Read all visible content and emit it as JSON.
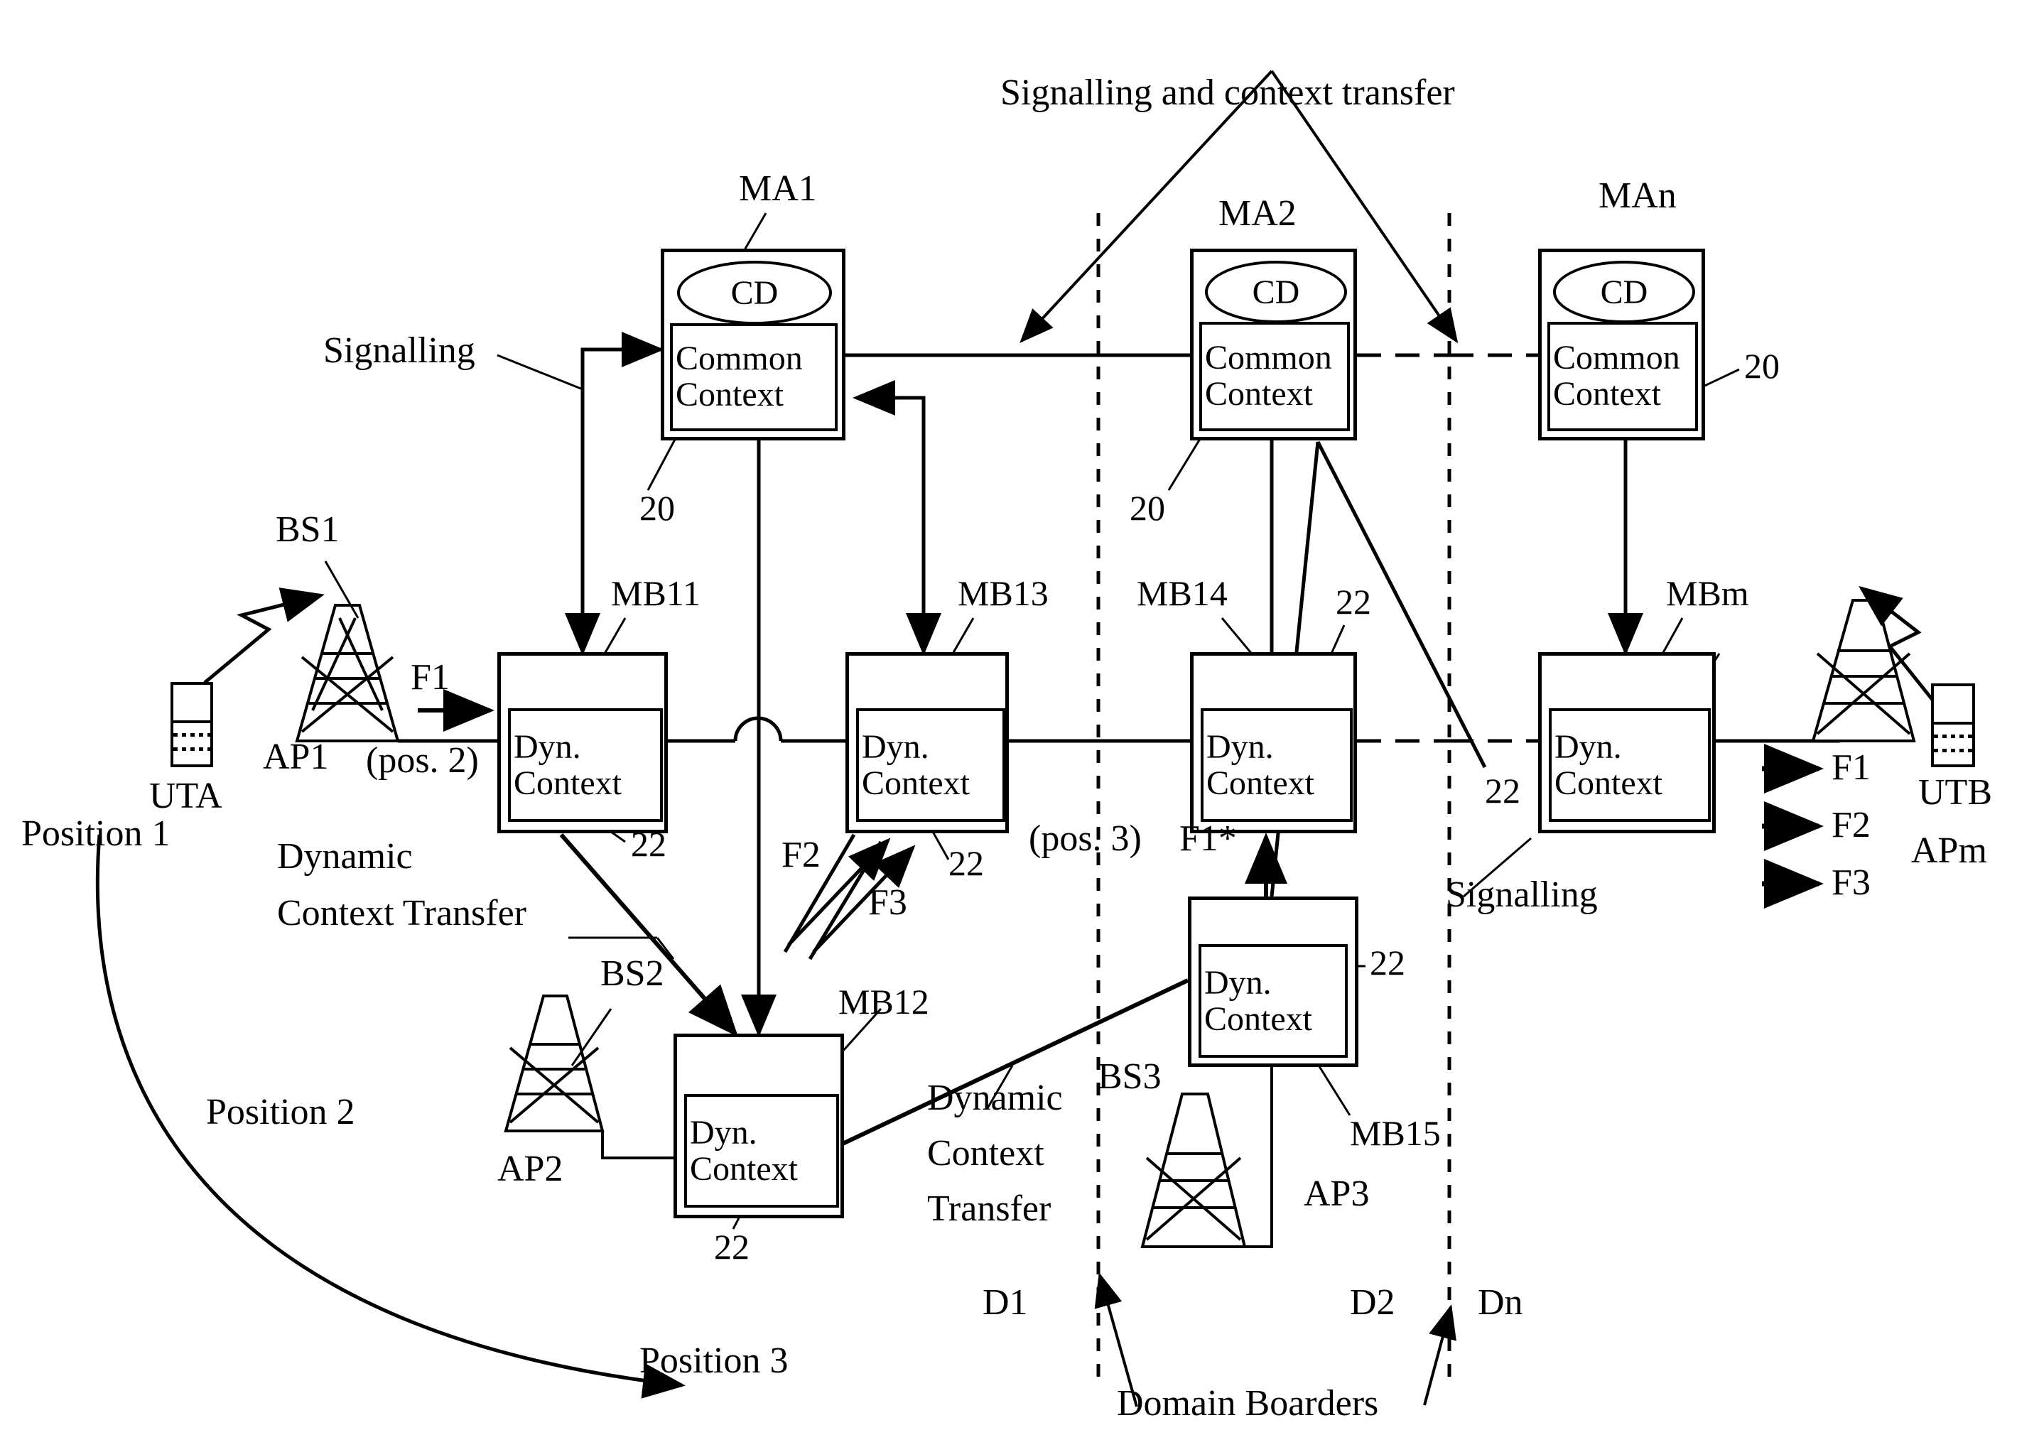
{
  "figure": {
    "title_top": "Signalling and context transfer",
    "domain_label": "Domain Boarders"
  },
  "agents": [
    {
      "id": "MA1",
      "label": "MA1",
      "cd": "CD",
      "context_line1": "Common",
      "context_line2": "Context",
      "ref": "20"
    },
    {
      "id": "MA2",
      "label": "MA2",
      "cd": "CD",
      "context_line1": "Common",
      "context_line2": "Context",
      "ref": "20"
    },
    {
      "id": "MAn",
      "label": "MAn",
      "cd": "CD",
      "context_line1": "Common",
      "context_line2": "Context",
      "ref": "20"
    }
  ],
  "brokers": [
    {
      "id": "MB11",
      "label": "MB11",
      "dyn_line1": "Dyn.",
      "dyn_line2": "Context",
      "ref": "22"
    },
    {
      "id": "MB13",
      "label": "MB13",
      "dyn_line1": "Dyn.",
      "dyn_line2": "Context",
      "ref": "22"
    },
    {
      "id": "MB14",
      "label": "MB14",
      "dyn_line1": "Dyn.",
      "dyn_line2": "Context",
      "ref": "22"
    },
    {
      "id": "MBm",
      "label": "MBm",
      "dyn_line1": "Dyn.",
      "dyn_line2": "Context",
      "ref": "22"
    },
    {
      "id": "MB12",
      "label": "MB12",
      "dyn_line1": "Dyn.",
      "dyn_line2": "Context",
      "ref": "22"
    },
    {
      "id": "MB15",
      "label": "MB15",
      "dyn_line1": "Dyn.",
      "dyn_line2": "Context",
      "ref": "22"
    }
  ],
  "base_stations": [
    {
      "id": "BS1",
      "label": "BS1",
      "ap": "AP1"
    },
    {
      "id": "BS2",
      "label": "BS2",
      "ap": "AP2"
    },
    {
      "id": "BS3",
      "label": "BS3",
      "ap": "AP3"
    },
    {
      "id": "BSm",
      "label": "",
      "ap": "APm"
    }
  ],
  "terminals": [
    {
      "id": "UTA",
      "label": "UTA"
    },
    {
      "id": "UTB",
      "label": "UTB"
    }
  ],
  "positions": {
    "p1": "Position 1",
    "p2": "Position 2",
    "p3": "Position 3",
    "pos2_tag": "(pos. 2)",
    "pos3_tag": "(pos. 3)"
  },
  "flows": {
    "f1": "F1",
    "f2": "F2",
    "f3": "F3",
    "f1_star": "F1*",
    "right_f1": "F1",
    "right_f2": "F2",
    "right_f3": "F3"
  },
  "annotations": {
    "signalling_left": "Signalling",
    "signalling_right": "Signalling",
    "dct_left_line1": "Dynamic",
    "dct_left_line2": "Context Transfer",
    "dct_mid_line1": "Dynamic",
    "dct_mid_line2": "Context",
    "dct_mid_line3": "Transfer"
  },
  "domains": [
    {
      "id": "D1",
      "label": "D1"
    },
    {
      "id": "D2",
      "label": "D2"
    },
    {
      "id": "Dn",
      "label": "Dn"
    }
  ],
  "refs": {
    "ma1_20": "20",
    "ma2_20": "20",
    "man_20": "20",
    "mb11_22": "22",
    "mb13_22": "22",
    "mb14_22": "22",
    "mbm_22": "22",
    "mb12_22": "22",
    "mb15_22": "22"
  },
  "colors": {
    "ink": "#000000",
    "paper": "#ffffff"
  }
}
